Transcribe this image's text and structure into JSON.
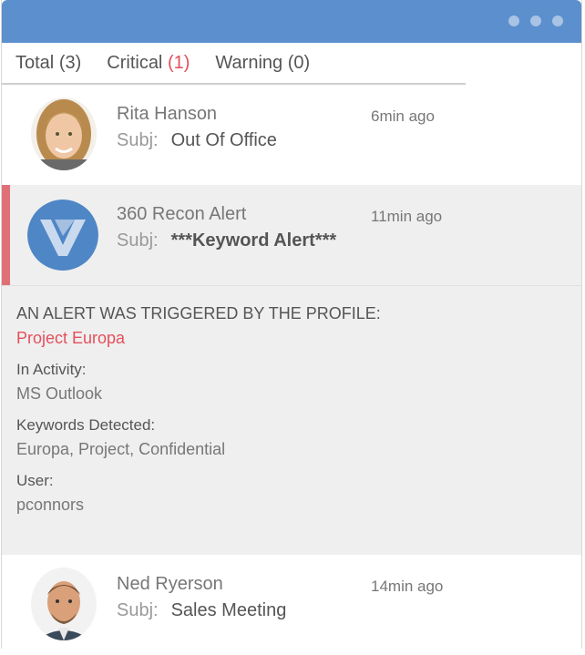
{
  "tabs": [
    {
      "label": "Total",
      "count": "(3)"
    },
    {
      "label": "Critical",
      "count": "(1)"
    },
    {
      "label": "Warning",
      "count": "(0)"
    }
  ],
  "messages": [
    {
      "sender": "Rita Hanson",
      "time": "6min ago",
      "subj_label": "Subj:",
      "subject": "Out Of Office"
    },
    {
      "sender": "360 Recon Alert",
      "time": "11min ago",
      "subj_label": "Subj:",
      "subject": "***Keyword Alert***"
    },
    {
      "sender": "Ned Ryerson",
      "time": "14min ago",
      "subj_label": "Subj:",
      "subject": "Sales Meeting"
    }
  ],
  "detail": {
    "heading": "AN ALERT WAS TRIGGERED BY THE PROFILE:",
    "profile": "Project Europa",
    "activity_label": "In Activity:",
    "activity": "MS Outlook",
    "keywords_label": "Keywords Detected:",
    "keywords": "Europa, Project, Confidential",
    "user_label": "User:",
    "user": "pconnors"
  },
  "colors": {
    "titlebar": "#5b8fcd",
    "critical": "#e2505c",
    "accent": "#e07077",
    "logo": "#4f86c6"
  }
}
